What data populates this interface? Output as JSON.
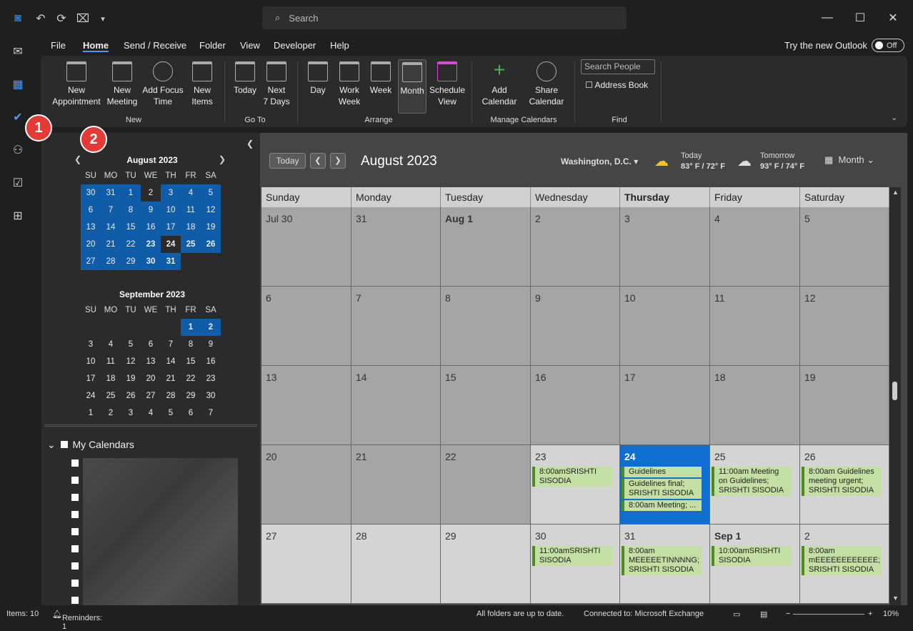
{
  "app": {
    "search_placeholder": "Search"
  },
  "menu": [
    "File",
    "Home",
    "Send / Receive",
    "Folder",
    "View",
    "Developer",
    "Help"
  ],
  "toggle": {
    "label": "Try the new Outlook",
    "state": "Off"
  },
  "ribbon": {
    "new": [
      "New\nAppointment",
      "New\nMeeting",
      "Add Focus\nTime",
      "New\nItems"
    ],
    "goto": [
      "Today",
      "Next\n7 Days"
    ],
    "arrange": [
      "Day",
      "Work\nWeek",
      "Week",
      "Month",
      "Schedule\nView"
    ],
    "manage": [
      "Add\nCalendar",
      "Share\nCalendar"
    ],
    "find": {
      "search_people": "Search People",
      "address_book": "Address Book"
    },
    "groups": {
      "new": "New",
      "goto": "Go To",
      "arrange": "Arrange",
      "manage": "Manage Calendars",
      "find": "Find"
    }
  },
  "mini_aug": {
    "title": "August 2023",
    "days": [
      "SU",
      "MO",
      "TU",
      "WE",
      "TH",
      "FR",
      "SA"
    ],
    "weeks": [
      [
        "30",
        "31",
        "1",
        "2",
        "3",
        "4",
        "5"
      ],
      [
        "6",
        "7",
        "8",
        "9",
        "10",
        "11",
        "12"
      ],
      [
        "13",
        "14",
        "15",
        "16",
        "17",
        "18",
        "19"
      ],
      [
        "20",
        "21",
        "22",
        "23",
        "24",
        "25",
        "26"
      ],
      [
        "27",
        "28",
        "29",
        "30",
        "31",
        "",
        ""
      ]
    ]
  },
  "mini_sep": {
    "title": "September 2023",
    "weeks": [
      [
        "",
        "",
        "",
        "",
        "",
        "1",
        "2"
      ],
      [
        "3",
        "4",
        "5",
        "6",
        "7",
        "8",
        "9"
      ],
      [
        "10",
        "11",
        "12",
        "13",
        "14",
        "15",
        "16"
      ],
      [
        "17",
        "18",
        "19",
        "20",
        "21",
        "22",
        "23"
      ],
      [
        "24",
        "25",
        "26",
        "27",
        "28",
        "29",
        "30"
      ],
      [
        "1",
        "2",
        "3",
        "4",
        "5",
        "6",
        "7"
      ]
    ]
  },
  "my_calendars": "My Calendars",
  "header": {
    "today": "Today",
    "title": "August 2023",
    "location": "Washington,  D.C.",
    "today_wx": {
      "label": "Today",
      "temp": "83° F / 72° F"
    },
    "tomorrow_wx": {
      "label": "Tomorrow",
      "temp": "93° F / 74° F"
    },
    "view": "Month"
  },
  "weekdays": [
    "Sunday",
    "Monday",
    "Tuesday",
    "Wednesday",
    "Thursday",
    "Friday",
    "Saturday"
  ],
  "weeks": [
    [
      "Jul 30",
      "31",
      "Aug 1",
      "2",
      "3",
      "4",
      "5"
    ],
    [
      "6",
      "7",
      "8",
      "9",
      "10",
      "11",
      "12"
    ],
    [
      "13",
      "14",
      "15",
      "16",
      "17",
      "18",
      "19"
    ],
    [
      "20",
      "21",
      "22",
      "23",
      "24",
      "25",
      "26"
    ],
    [
      "27",
      "28",
      "29",
      "30",
      "31",
      "Sep 1",
      "2"
    ]
  ],
  "events": {
    "w3d3": [
      "8:00amSRISHTI SISODIA"
    ],
    "w3d4": [
      "Guidelines",
      "Guidelines final; SRISHTI SISODIA",
      "8:00am Meeting; ..."
    ],
    "w3d5": [
      "11:00am Meeting on Guidelines; SRISHTI SISODIA"
    ],
    "w3d6": [
      "8:00am Guidelines meeting urgent; SRISHTI SISODIA"
    ],
    "w4d3": [
      "11:00amSRISHTI SISODIA"
    ],
    "w4d4": [
      "8:00am MEEEEETINNNNG; SRISHTI SISODIA"
    ],
    "w4d5": [
      "10:00amSRISHTI SISODIA"
    ],
    "w4d6": [
      "8:00am mEEEEEEEEEEEE; SRISHTI SISODIA"
    ]
  },
  "status": {
    "items": "Items: 10",
    "reminders": "Reminders: 1",
    "sync": "All folders are up to date.",
    "connected": "Connected to: Microsoft Exchange",
    "zoom": "10%"
  },
  "badges": [
    "1",
    "2"
  ]
}
